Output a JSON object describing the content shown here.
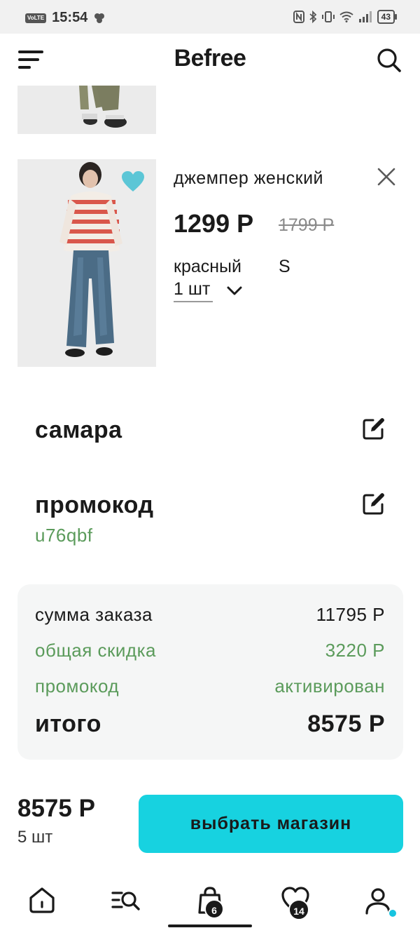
{
  "status_bar": {
    "network_tag": "VoLTE",
    "time": "15:54",
    "battery": "43"
  },
  "header": {
    "brand": "Befree"
  },
  "cart_item": {
    "name": "джемпер женский",
    "price": "1299 Р",
    "old_price": "1799 Р",
    "color": "красный",
    "size": "S",
    "quantity": "1 шт"
  },
  "delivery": {
    "city": "самара"
  },
  "promo": {
    "title": "промокод",
    "code": "u76qbf"
  },
  "summary": {
    "order_sum_label": "сумма заказа",
    "order_sum_value": "11795 Р",
    "discount_label": "общая скидка",
    "discount_value": "3220 Р",
    "promo_label": "промокод",
    "promo_value": "активирован",
    "total_label": "итого",
    "total_value": "8575 Р"
  },
  "checkout": {
    "total": "8575 Р",
    "count": "5 шт",
    "button_label": "выбрать магазин"
  },
  "bottom_nav": {
    "cart_badge": "6",
    "favorites_badge": "14"
  },
  "colors": {
    "accent": "#17d2e0",
    "green_text": "#5b9b5b",
    "heart": "#5cc6d6",
    "summary_bg": "#f5f6f6"
  }
}
